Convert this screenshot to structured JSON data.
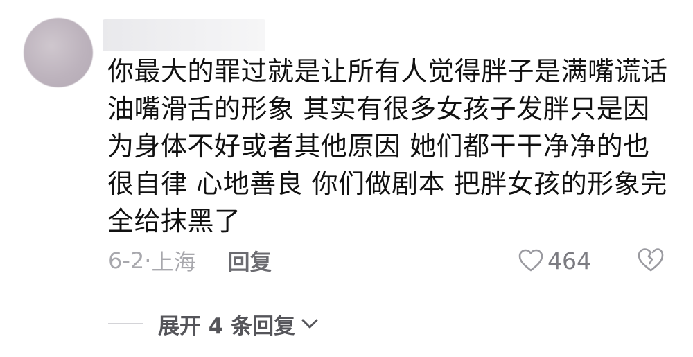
{
  "comment": {
    "username": "",
    "text": "你最大的罪过就是让所有人觉得胖子是满嘴谎话油嘴滑舌的形象 其实有很多女孩子发胖只是因为身体不好或者其他原因 她们都干干净净的也很自律 心地善良 你们做剧本 把胖女孩的形象完全给抹黑了",
    "date": "6-2",
    "location_separator": "·",
    "location": "上海",
    "reply_label": "回复",
    "like_count": "464",
    "expand_label": "展开 4 条回复",
    "icons": {
      "like": "heart-icon",
      "dislike": "broken-heart-icon",
      "expand": "chevron-down-icon"
    }
  }
}
